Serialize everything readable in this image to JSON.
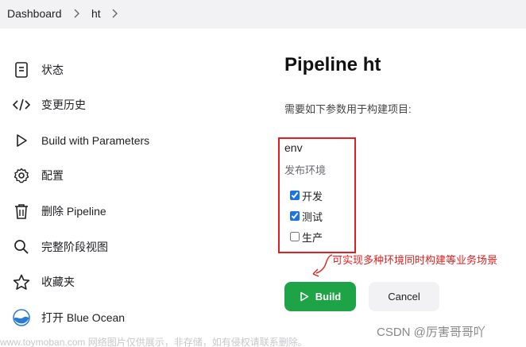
{
  "breadcrumb": {
    "items": [
      "Dashboard",
      "ht"
    ]
  },
  "sidebar": {
    "items": [
      {
        "label": "状态",
        "icon": "document-icon"
      },
      {
        "label": "变更历史",
        "icon": "code-icon"
      },
      {
        "label": "Build with Parameters",
        "icon": "play-icon"
      },
      {
        "label": "配置",
        "icon": "gear-icon"
      },
      {
        "label": "删除 Pipeline",
        "icon": "trash-icon"
      },
      {
        "label": "完整阶段视图",
        "icon": "search-icon"
      },
      {
        "label": "收藏夹",
        "icon": "star-icon"
      },
      {
        "label": "打开 Blue Ocean",
        "icon": "blue-ocean-icon"
      }
    ]
  },
  "main": {
    "title": "Pipeline ht",
    "description": "需要如下参数用于构建项目:",
    "parameter": {
      "name": "env",
      "description": "发布环境",
      "options": [
        {
          "label": "开发",
          "checked": true
        },
        {
          "label": "测试",
          "checked": true
        },
        {
          "label": "生产",
          "checked": false
        }
      ]
    },
    "annotation": "可实现多种环境同时构建等业务场景",
    "build_label": "Build",
    "cancel_label": "Cancel"
  },
  "watermark": "www.toymoban.com 网络图片仅供展示，非存储，如有侵权请联系删除。",
  "csdn_credit": "CSDN @厉害哥哥吖",
  "colors": {
    "build_green": "#1ea446",
    "annotation_red": "#e02020",
    "topbar_bg": "#f2f2f4"
  }
}
